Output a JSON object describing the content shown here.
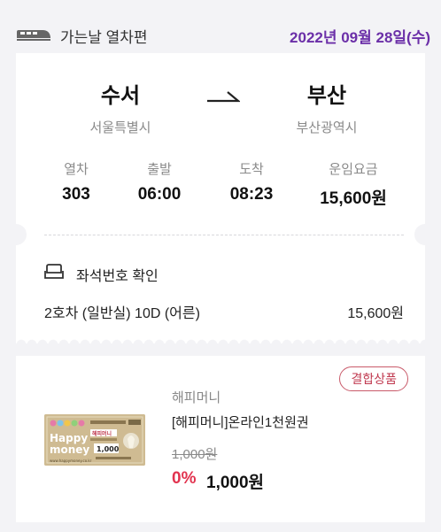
{
  "header": {
    "icon": "train-icon",
    "label": "가는날 열차편",
    "date": "2022년 09월 28일(수)",
    "date_color": "#6b2fa8"
  },
  "ticket": {
    "departure": {
      "station": "수서",
      "city": "서울특별시"
    },
    "arrival": {
      "station": "부산",
      "city": "부산광역시"
    },
    "arrow_icon": "arrow-right-icon",
    "info": [
      {
        "label": "열차",
        "value": "303"
      },
      {
        "label": "출발",
        "value": "06:00"
      },
      {
        "label": "도착",
        "value": "08:23"
      },
      {
        "label": "운임요금",
        "value": "15,600원"
      }
    ],
    "seat": {
      "icon": "seat-icon",
      "title": "좌석번호 확인",
      "info": "2호차 (일반실) 10D (어른)",
      "price": "15,600원"
    }
  },
  "product": {
    "badge": "결합상품",
    "badge_color": "#c0394f",
    "brand": "해피머니",
    "name": "[해피머니]온라인1천원권",
    "original_price": "1,000원",
    "discount": "0%",
    "discount_color": "#e2334f",
    "final_price": "1,000원",
    "card": {
      "top_text": "문화상품권",
      "brand_ko": "해피머니",
      "brand_en_1": "Happy",
      "brand_en_2": "money",
      "amount": "1,000",
      "url": "www.happymoney.co.kr"
    }
  }
}
